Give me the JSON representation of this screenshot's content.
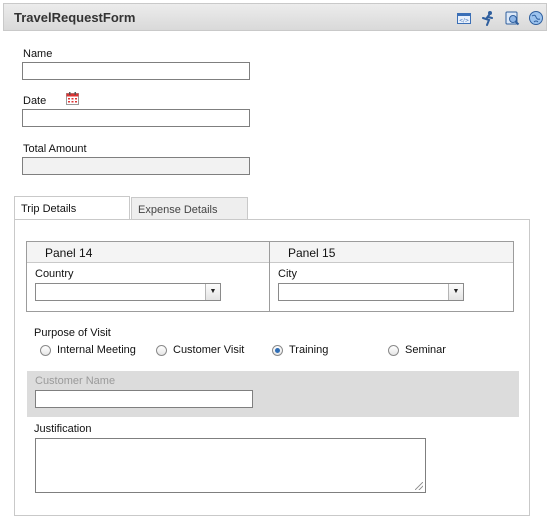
{
  "form": {
    "title": "TravelRequestForm",
    "toolbar_icons": [
      "form-view-icon",
      "run-icon",
      "preview-icon",
      "globe-icon"
    ]
  },
  "fields": {
    "name_label": "Name",
    "date_label": "Date",
    "date_icon": "calendar-icon",
    "total_label": "Total Amount"
  },
  "tabs": [
    {
      "label": "Trip Details",
      "active": true
    },
    {
      "label": "Expense Details",
      "active": false
    }
  ],
  "trip": {
    "panel14": {
      "title": "Panel 14",
      "label": "Country",
      "value": ""
    },
    "panel15": {
      "title": "Panel 15",
      "label": "City",
      "value": ""
    },
    "purpose_label": "Purpose of Visit",
    "purpose_options": [
      {
        "label": "Internal Meeting",
        "selected": false
      },
      {
        "label": "Customer Visit",
        "selected": false
      },
      {
        "label": "Training",
        "selected": true
      },
      {
        "label": "Seminar",
        "selected": false
      }
    ],
    "customer_name_label": "Customer Name",
    "justification_label": "Justification"
  },
  "colors": {
    "radio_selected": "#2f6db5",
    "disabled_bg": "#dcdcdc"
  }
}
